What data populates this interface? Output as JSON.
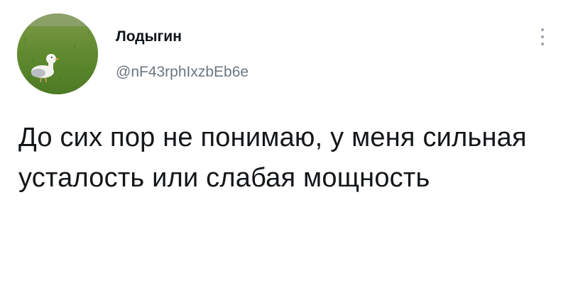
{
  "tweet": {
    "author": {
      "display_name": "Лодыгин",
      "handle": "@nF43rphIxzbEb6e",
      "avatar_icon": "seagull-on-grass-avatar"
    },
    "more_icon": "more-vertical-icon",
    "text": "До сих пор не понимаю, у меня сильная усталость или слабая мощность"
  },
  "colors": {
    "name": "#0f1419",
    "handle": "#6b7680",
    "body_text": "#14171a",
    "background": "#ffffff"
  }
}
